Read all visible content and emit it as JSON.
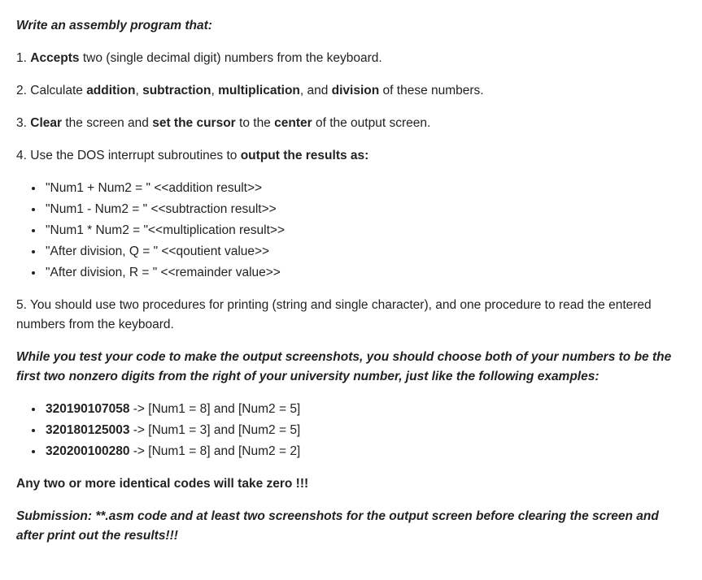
{
  "title": "Write an assembly program that:",
  "step1": {
    "pre": "",
    "accepts": "Accepts",
    "post": " two (single decimal digit) numbers from the keyboard."
  },
  "step2": {
    "t1": "Calculate ",
    "add": "addition",
    "t2": ", ",
    "sub": "subtraction",
    "t3": ", ",
    "mul": "multiplication",
    "t4": ", and ",
    "div": "division",
    "t5": " of these numbers."
  },
  "step3": {
    "clear": "Clear",
    "t1": " the screen and ",
    "setcursor": "set the cursor",
    "t2": " to the ",
    "center": "center",
    "t3": " of the output screen."
  },
  "step4": {
    "t1": "Use the  DOS interrupt subroutines to ",
    "out": "output the results as:"
  },
  "outputs": {
    "l1": "\"Num1 + Num2 = \" <<addition result>>",
    "l2": "\"Num1 - Num2 = \" <<subtraction result>>",
    "l3": "\"Num1 * Num2 = \"<<multiplication result>>",
    "l4": "\"After division, Q = \" <<qoutient value>>",
    "l5": "\"After division, R = \"  <<remainder value>>"
  },
  "step5": "You should use two procedures for printing (string and single character), and one procedure to read the entered numbers from the keyboard.",
  "test_note": "While you test your code to make the output screenshots, you should choose both of your numbers to be the first two nonzero digits from the right of your university number, just like the following examples:",
  "examples": {
    "e1num": "320190107058",
    "e1txt": " -> [Num1 = 8] and [Num2 = 5]",
    "e2num": "320180125003",
    "e2txt": " -> [Num1 = 3] and [Num2 = 5]",
    "e3num": "320200100280",
    "e3txt": " -> [Num1 = 8] and [Num2 = 2]"
  },
  "warning": "Any two or more identical codes will take zero !!!",
  "submission": {
    "label": "Submission: ",
    "text": "**.asm code and at least two screenshots for the output screen before clearing the screen and after print out the results!!!"
  }
}
